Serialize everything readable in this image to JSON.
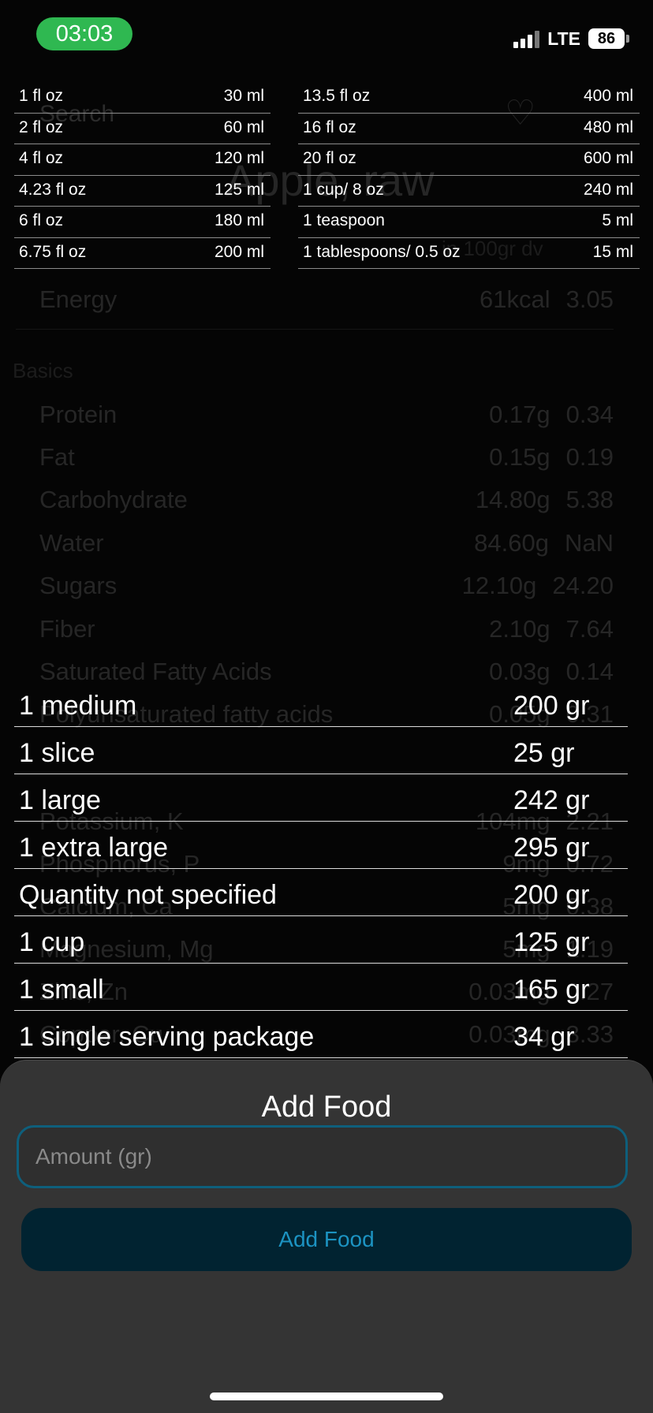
{
  "status_bar": {
    "time": "03:03",
    "network": "LTE",
    "battery": "86"
  },
  "background": {
    "search_placeholder": "Search",
    "food_title": "Apple, raw",
    "per_label": "in 100gr  dv",
    "section_label": "Basics",
    "rows": [
      {
        "name": "Energy",
        "value": "61kcal",
        "dv": "3.05"
      },
      {
        "name": "Protein",
        "value": "0.17g",
        "dv": "0.34"
      },
      {
        "name": "Fat",
        "value": "0.15g",
        "dv": "0.19"
      },
      {
        "name": "Carbohydrate",
        "value": "14.80g",
        "dv": "5.38"
      },
      {
        "name": "Water",
        "value": "84.60g",
        "dv": "NaN"
      },
      {
        "name": "Sugars",
        "value": "12.10g",
        "dv": "24.20"
      },
      {
        "name": "Fiber",
        "value": "2.10g",
        "dv": "7.64"
      },
      {
        "name": "Saturated Fatty Acids",
        "value": "0.03g",
        "dv": "0.14"
      },
      {
        "name": "Polyunsaturated fatty acids",
        "value": "0.05g",
        "dv": "0.31"
      },
      {
        "name": "Potassium, K",
        "value": "104mg",
        "dv": "2.21"
      },
      {
        "name": "Phosphorus, P",
        "value": "9mg",
        "dv": "0.72"
      },
      {
        "name": "Calcium, Ca",
        "value": "5mg",
        "dv": "0.38"
      },
      {
        "name": "Magnesium, Mg",
        "value": "5mg",
        "dv": "1.19"
      },
      {
        "name": "Zinc, Zn",
        "value": "0.03mg",
        "dv": "0.27"
      },
      {
        "name": "Copper, Cu",
        "value": "0.03mg",
        "dv": "3.33"
      }
    ]
  },
  "conversions_left": [
    {
      "label": "1 fl oz",
      "value": "30 ml"
    },
    {
      "label": "2 fl oz",
      "value": "60 ml"
    },
    {
      "label": "4 fl oz",
      "value": "120 ml"
    },
    {
      "label": "4.23 fl oz",
      "value": "125 ml"
    },
    {
      "label": "6 fl oz",
      "value": "180 ml"
    },
    {
      "label": "6.75 fl oz",
      "value": "200 ml"
    }
  ],
  "conversions_right": [
    {
      "label": "13.5 fl oz",
      "value": "400 ml"
    },
    {
      "label": "16 fl oz",
      "value": "480 ml"
    },
    {
      "label": "20 fl oz",
      "value": "600 ml"
    },
    {
      "label": "1 cup/ 8 oz",
      "value": "240 ml"
    },
    {
      "label": "1 teaspoon",
      "value": "5 ml"
    },
    {
      "label": "1 tablespoons/ 0.5 oz",
      "value": "15 ml"
    }
  ],
  "portions": [
    {
      "label": "1 medium",
      "amount": "200 gr"
    },
    {
      "label": "1 slice",
      "amount": "25 gr"
    },
    {
      "label": "1 large",
      "amount": "242 gr"
    },
    {
      "label": "1 extra large",
      "amount": "295 gr"
    },
    {
      "label": "Quantity not specified",
      "amount": "200 gr"
    },
    {
      "label": "1 cup",
      "amount": "125 gr"
    },
    {
      "label": "1 small",
      "amount": "165 gr"
    },
    {
      "label": "1 single serving package",
      "amount": "34 gr"
    }
  ],
  "sheet": {
    "title": "Add Food",
    "input_placeholder": "Amount (gr)",
    "input_value": "",
    "button_label": "Add Food"
  },
  "colors": {
    "status_pill": "#2fb851",
    "accent": "#1c93c2",
    "input_border": "#0e5f7c",
    "button_bg": "#012331"
  }
}
